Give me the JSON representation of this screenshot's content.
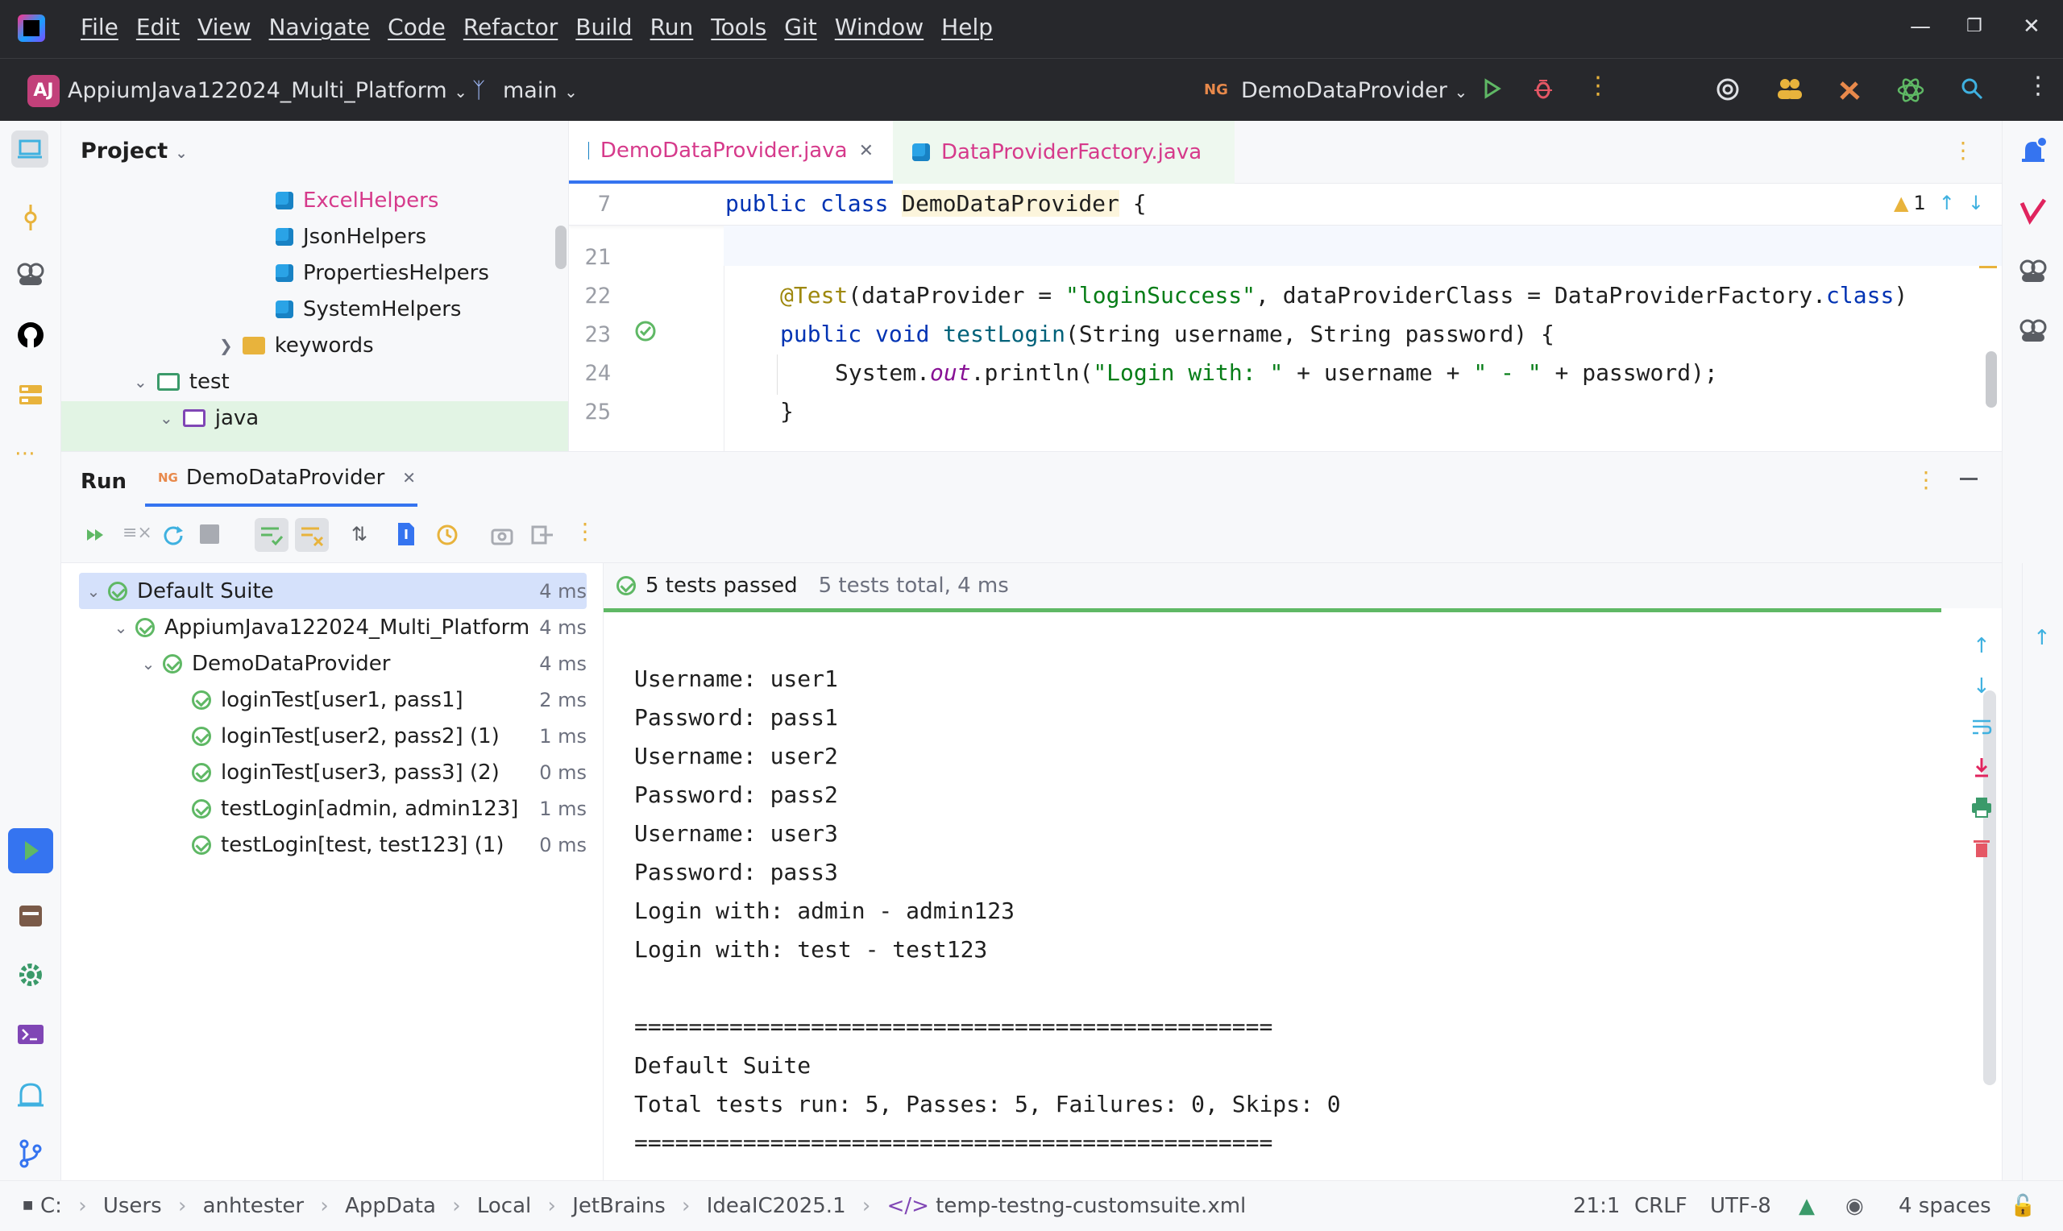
{
  "menu": [
    "File",
    "Edit",
    "View",
    "Navigate",
    "Code",
    "Refactor",
    "Build",
    "Run",
    "Tools",
    "Git",
    "Window",
    "Help"
  ],
  "toolbar": {
    "project_badge": "AJ",
    "project_name": "AppiumJava122024_Multi_Platform",
    "branch": "main",
    "run_config_badge": "NG",
    "run_config": "DemoDataProvider"
  },
  "project_panel": {
    "title": "Project",
    "items": [
      {
        "label": "ExcelHelpers",
        "type": "class",
        "highlight": true
      },
      {
        "label": "JsonHelpers",
        "type": "class"
      },
      {
        "label": "PropertiesHelpers",
        "type": "class"
      },
      {
        "label": "SystemHelpers",
        "type": "class"
      },
      {
        "label": "keywords",
        "type": "folder"
      },
      {
        "label": "test",
        "type": "test-root"
      },
      {
        "label": "java",
        "type": "source-root"
      }
    ]
  },
  "editor": {
    "tabs": [
      {
        "label": "DemoDataProvider.java",
        "active": true
      },
      {
        "label": "DataProviderFactory.java",
        "active": false
      }
    ],
    "sticky_line_number": "7",
    "sticky_code": {
      "kw1": "public",
      "kw2": "class",
      "name": "DemoDataProvider",
      "brace": "{"
    },
    "warning_count": "1",
    "lines": [
      {
        "n": "21"
      },
      {
        "n": "22"
      },
      {
        "n": "23"
      },
      {
        "n": "24"
      },
      {
        "n": "25"
      }
    ],
    "code": {
      "l22_ann": "@Test",
      "l22_a": "(dataProvider = ",
      "l22_str": "\"loginSuccess\"",
      "l22_b": ", dataProviderClass = DataProviderFactory.",
      "l22_kw": "class",
      "l22_c": ")",
      "l23_kw": "public void",
      "l23_fn": "testLogin",
      "l23_rest": "(String username, String password) {",
      "l24_a": "System.",
      "l24_it": "out",
      "l24_b": ".println(",
      "l24_str1": "\"Login with: \"",
      "l24_c": " + username + ",
      "l24_str2": "\" - \"",
      "l24_d": " + password);",
      "l25": "}"
    }
  },
  "run_panel": {
    "title": "Run",
    "tab_badge": "NG",
    "tab_label": "DemoDataProvider",
    "tests": [
      {
        "label": "Default Suite",
        "duration": "4 ms",
        "level": 0,
        "expanded": true,
        "selected": true
      },
      {
        "label": "AppiumJava122024_Multi_Platform",
        "duration": "4 ms",
        "level": 1,
        "expanded": true
      },
      {
        "label": "DemoDataProvider",
        "duration": "4 ms",
        "level": 2,
        "expanded": true
      },
      {
        "label": "loginTest[user1, pass1]",
        "duration": "2 ms",
        "level": 3
      },
      {
        "label": "loginTest[user2, pass2] (1)",
        "duration": "1 ms",
        "level": 3
      },
      {
        "label": "loginTest[user3, pass3] (2)",
        "duration": "0 ms",
        "level": 3
      },
      {
        "label": "testLogin[admin, admin123]",
        "duration": "1 ms",
        "level": 3
      },
      {
        "label": "testLogin[test, test123] (1)",
        "duration": "0 ms",
        "level": 3
      }
    ],
    "summary_passed": "5 tests passed",
    "summary_total": "5 tests total, 4 ms",
    "output": [
      "Username: user1",
      "Password: pass1",
      "Username: user2",
      "Password: pass2",
      "Username: user3",
      "Password: pass3",
      "Login with: admin - admin123",
      "Login with: test - test123",
      "",
      "===============================================",
      "Default Suite",
      "Total tests run: 5, Passes: 5, Failures: 0, Skips: 0",
      "==============================================="
    ]
  },
  "statusbar": {
    "breadcrumbs": [
      "C:",
      "Users",
      "anhtester",
      "AppData",
      "Local",
      "JetBrains",
      "IdeaIC2025.1",
      "temp-testng-customsuite.xml"
    ],
    "position": "21:1",
    "line_sep": "CRLF",
    "encoding": "UTF-8",
    "indent": "4 spaces"
  },
  "colors": {
    "accent": "#3574f0",
    "pass": "#5fb865",
    "titlebar": "#27282c",
    "tab_text": "#d63a8b"
  }
}
